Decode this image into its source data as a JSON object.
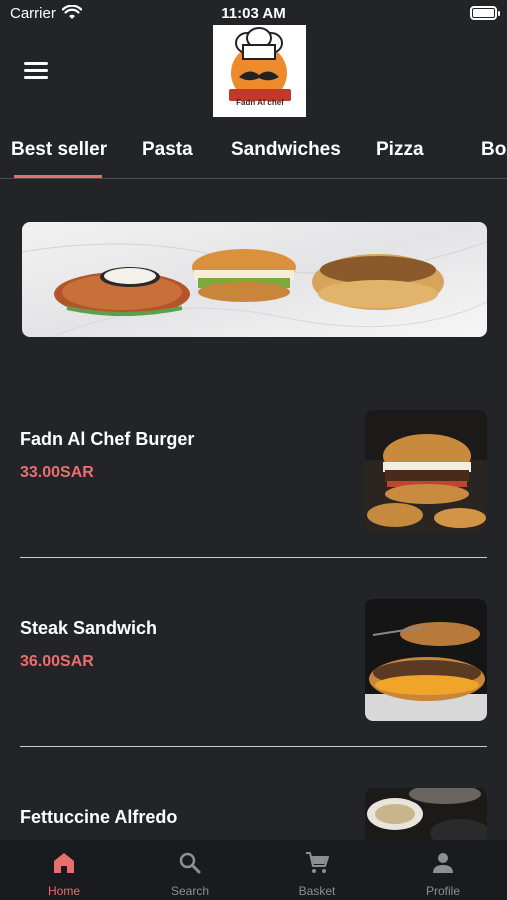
{
  "status_bar": {
    "carrier": "Carrier",
    "time": "11:03 AM"
  },
  "header": {
    "menu_icon": "hamburger-menu-icon",
    "logo_text": "Fadn Al chef"
  },
  "tabs": [
    {
      "label": "Best seller",
      "active": true
    },
    {
      "label": "Pasta",
      "active": false
    },
    {
      "label": "Sandwiches",
      "active": false
    },
    {
      "label": "Pizza",
      "active": false
    },
    {
      "label": "Box",
      "active": false
    }
  ],
  "products": [
    {
      "name": "Fadn Al Chef Burger",
      "price": "33.00SAR",
      "image": "burger-fries-photo"
    },
    {
      "name": "Steak Sandwich",
      "price": "36.00SAR",
      "image": "steak-sandwich-photo"
    },
    {
      "name": "Fettuccine Alfredo",
      "price": "",
      "image": "fettuccine-photo"
    }
  ],
  "bottom_nav": [
    {
      "label": "Home",
      "icon": "home-icon",
      "active": true
    },
    {
      "label": "Search",
      "icon": "search-icon",
      "active": false
    },
    {
      "label": "Basket",
      "icon": "cart-icon",
      "active": false
    },
    {
      "label": "Profile",
      "icon": "person-icon",
      "active": false
    }
  ],
  "colors": {
    "background": "#232428",
    "accent": "#e96f6f",
    "nav_background": "#1a1b1e",
    "inactive": "#8e8f93"
  }
}
